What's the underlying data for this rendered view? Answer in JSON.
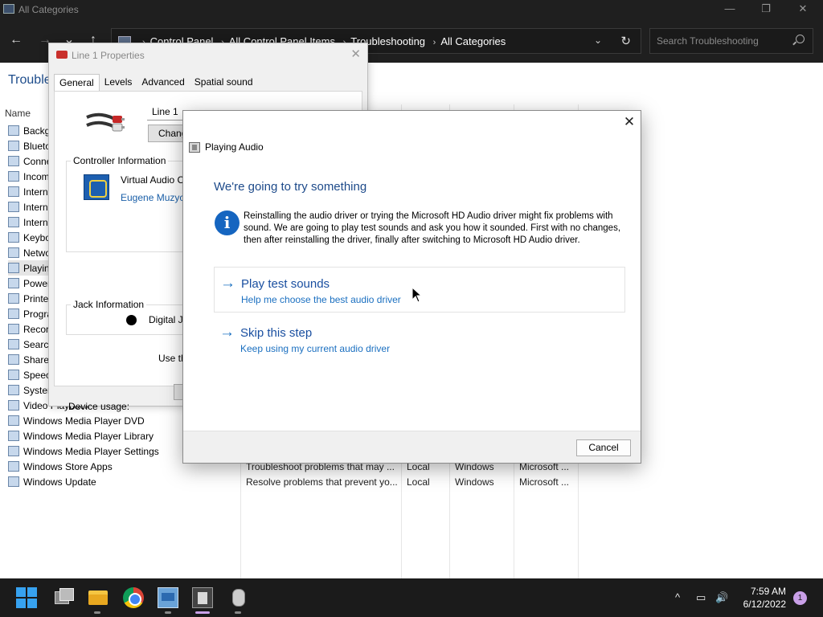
{
  "window": {
    "title": "All Categories",
    "controls": {
      "minimize": "—",
      "restore": "❐",
      "close": "✕"
    }
  },
  "nav": {
    "back": "←",
    "forward": "→",
    "recent": "⌄",
    "up": "↑"
  },
  "address": {
    "breadcrumb": [
      "Control Panel",
      "All Control Panel Items",
      "Troubleshooting",
      "All Categories"
    ],
    "separator": "›",
    "dropdown": "⌄",
    "refresh": "↻"
  },
  "search": {
    "placeholder": "Search Troubleshooting"
  },
  "page": {
    "heading": "Troubleshe",
    "column_name": "Name"
  },
  "categories": [
    {
      "name": "Backgr",
      "selected": false
    },
    {
      "name": "Blueto",
      "selected": false
    },
    {
      "name": "Conne",
      "selected": false
    },
    {
      "name": "Incom",
      "selected": false
    },
    {
      "name": "Intern",
      "selected": false
    },
    {
      "name": "Intern",
      "selected": false
    },
    {
      "name": "Intern",
      "selected": false
    },
    {
      "name": "Keybo",
      "selected": false
    },
    {
      "name": "Netwo",
      "selected": false
    },
    {
      "name": "Playin",
      "selected": true
    },
    {
      "name": "Power",
      "selected": false
    },
    {
      "name": "Printe",
      "selected": false
    },
    {
      "name": "Progra",
      "selected": false
    },
    {
      "name": "Recor",
      "selected": false
    },
    {
      "name": "Search",
      "selected": false
    },
    {
      "name": "Share",
      "selected": false
    },
    {
      "name": "Speec",
      "selected": false
    },
    {
      "name": "Syster",
      "selected": false
    },
    {
      "name": "Video Playback",
      "selected": false
    },
    {
      "name": "Windows Media Player DVD",
      "selected": false
    },
    {
      "name": "Windows Media Player Library",
      "selected": false
    },
    {
      "name": "Windows Media Player Settings",
      "selected": false
    },
    {
      "name": "Windows Store Apps",
      "selected": false
    },
    {
      "name": "Windows Update",
      "selected": false
    }
  ],
  "details": [
    {
      "description": "Troubleshoot problems that may ...",
      "location": "Local",
      "category": "Windows",
      "publisher": "Microsoft ..."
    },
    {
      "description": "Resolve problems that prevent yo...",
      "location": "Local",
      "category": "Windows",
      "publisher": "Microsoft ..."
    }
  ],
  "properties": {
    "title": "Line 1 Properties",
    "close": "✕",
    "tabs": [
      "General",
      "Levels",
      "Advanced",
      "Spatial sound"
    ],
    "device_name": "Line 1",
    "change_button": "Change",
    "controller_group": "Controller Information",
    "controller_name": "Virtual Audio C",
    "controller_vendor": "Eugene Muzych",
    "jack_group": "Jack Information",
    "jack_value": "Digital Ja",
    "usage_label": "Device usage:",
    "usage_value": "Use th"
  },
  "audio_dialog": {
    "title": "Playing Audio",
    "close": "✕",
    "heading": "We're going to try something",
    "info_glyph": "i",
    "body": "Reinstalling the audio driver or trying the Microsoft HD Audio driver might fix problems with sound. We are going to play test sounds and ask you how it sounded. First with no changes, then after reinstalling the driver, finally after switching to Microsoft HD Audio driver.",
    "options": [
      {
        "arrow": "→",
        "title": "Play test sounds",
        "subtitle": "Help me choose the best audio driver"
      },
      {
        "arrow": "→",
        "title": "Skip this step",
        "subtitle": "Keep using my current audio driver"
      }
    ],
    "cancel": "Cancel"
  },
  "taskbar": {
    "time": "7:59 AM",
    "date": "6/12/2022",
    "notifications": "1",
    "tray": {
      "chevron": "^",
      "network": "▭",
      "volume": "🔊"
    },
    "icons": [
      "start-icon",
      "task-view-icon",
      "file-explorer-icon",
      "chrome-icon",
      "control-panel-icon",
      "troubleshooter-icon",
      "microphone-icon"
    ]
  },
  "colors": {
    "accent": "#1a6fc0",
    "heading": "#1d4a8a",
    "titlebar": "#1f1f1f",
    "taskbar": "#1b1b1b",
    "info": "#1565c0"
  }
}
